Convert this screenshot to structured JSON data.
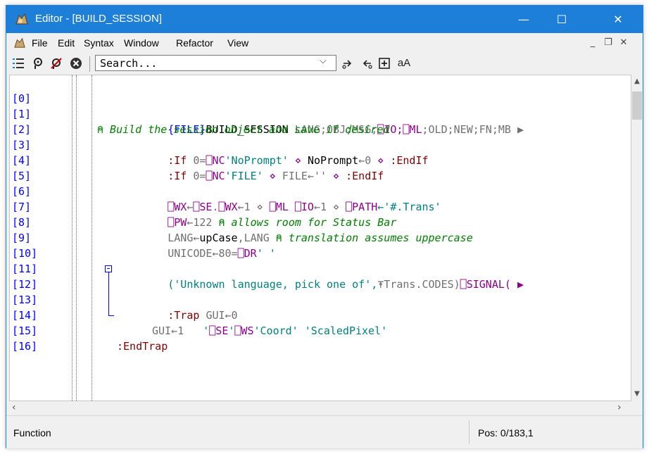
{
  "window": {
    "title": "Editor - [BUILD_SESSION]"
  },
  "menu": {
    "items": [
      "File",
      "Edit",
      "Syntax",
      "Window",
      "Refactor",
      "View"
    ]
  },
  "toolbar": {
    "search_placeholder": "Search...",
    "case_label": "aA"
  },
  "line_numbers": [
    "[0]",
    "[1]",
    "[2]",
    "[3]",
    "[4]",
    "[5]",
    "[6]",
    "[7]",
    "[8]",
    "[9]",
    "[10]",
    "[11]",
    "[12]",
    "[13]",
    "[14]",
    "[15]",
    "[16]"
  ],
  "code": {
    "l0": {
      "a": "{FILE}",
      "b": "BUILD_SESSION",
      "c": " LANG;OBJ;MSG;",
      "d": "⎕IO;⎕ML",
      "e": ";OLD;NEW;FN;MB ▶"
    },
    "l1": {
      "a": "⍝ Build the session object and save if desired"
    },
    "l2": {
      "a": ":If ",
      "b": "0=",
      "c": "⎕NC",
      "d": "'NoPrompt'",
      "e": " ⋄ ",
      "f": "NoPrompt",
      "g": "←0",
      "h": " ⋄ ",
      "i": ":EndIf"
    },
    "l3": {
      "a": ":If ",
      "b": "0=",
      "c": "⎕NC",
      "d": "'FILE'",
      "e": " ⋄ ",
      "f": "FILE←''",
      "h": " ⋄ ",
      "i": ":EndIf"
    },
    "l5": {
      "a": "⎕WX",
      "b": "←",
      "c": "⎕SE",
      "d": ".",
      "e": "⎕WX",
      "f": "←1 ⋄ ",
      "g": "⎕ML ⎕IO",
      "h": "←1 ⋄ ",
      "i": "⎕PATH",
      "j": "←'#.Trans'"
    },
    "l6": {
      "a": "⎕PW",
      "b": "←122 ",
      "c": "⍝ allows room for Status Bar"
    },
    "l7": {
      "a": "LANG←",
      "b": "upCase",
      "c": ",LANG ",
      "d": "⍝ translation assumes uppercase"
    },
    "l8": {
      "a": "UNICODE←80=",
      "b": "⎕DR",
      "c": "' '"
    },
    "l10": {
      "a": "('Unknown language, pick one of',",
      "b": "⍕Trans.CODES)",
      "c": "⎕SIGNAL( ▶"
    },
    "l12": {
      "a": ":Trap ",
      "b": "GUI←0"
    },
    "l13": {
      "a": "'",
      "b": "⎕SE",
      "c": "'",
      "d": "⎕WS",
      "e": "'Coord' 'ScaledPixel'"
    },
    "l14": {
      "a": "GUI←1"
    },
    "l15": {
      "a": ":EndTrap"
    }
  },
  "status": {
    "left": "Function",
    "position": "Pos: 0/183,1"
  },
  "colors": {
    "titlebar": "#1e7fd8",
    "line_number": "#0000ff",
    "comment": "#008000",
    "system": "#8b008b",
    "string": "#008080"
  },
  "icons": [
    "app-icon",
    "menu-app-icon",
    "line-numbers-icon",
    "search-icon",
    "clear-search-icon",
    "close-circle-icon",
    "dropdown-arrow-icon",
    "find-next-icon",
    "find-prev-icon",
    "add-icon"
  ]
}
